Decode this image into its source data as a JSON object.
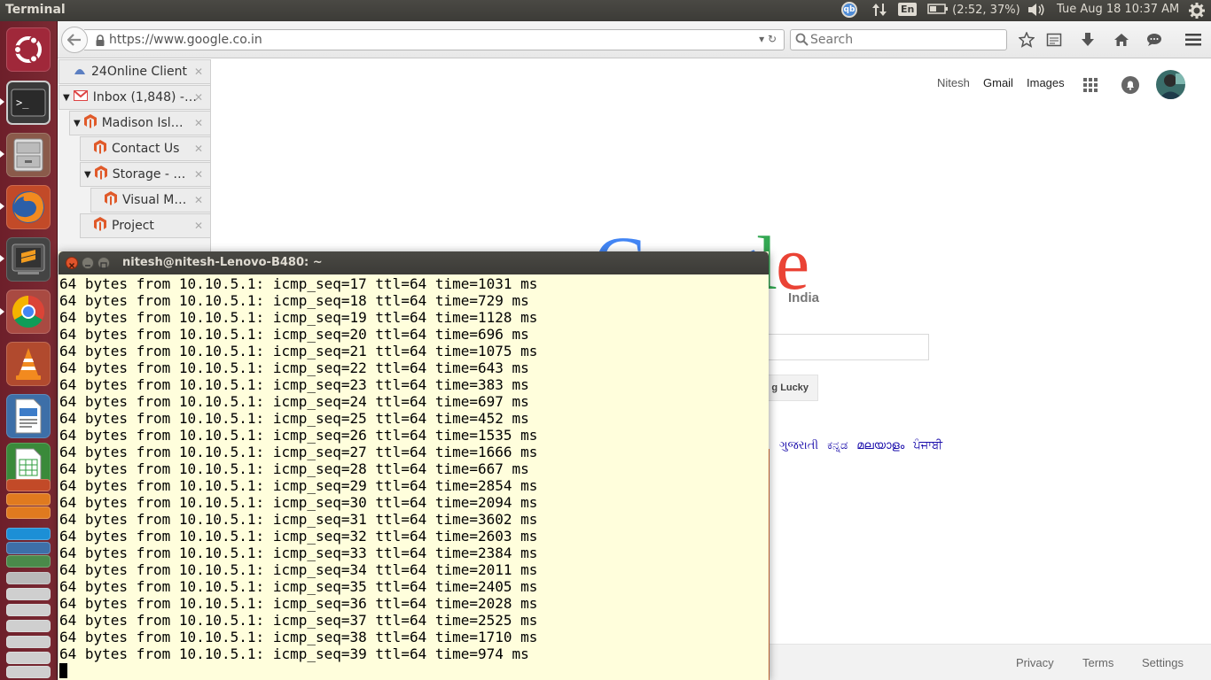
{
  "topbar": {
    "app_title": "Terminal",
    "keyboard_layout": "En",
    "battery": "(2:52, 37%)",
    "clock": "Tue Aug 18 10:37 AM",
    "tray_badge": "qb"
  },
  "launcher": {
    "items": [
      {
        "name": "ubuntu-dash",
        "icon": "ubuntu-logo-icon"
      },
      {
        "name": "terminal",
        "icon": "terminal-icon"
      },
      {
        "name": "files",
        "icon": "file-cabinet-icon"
      },
      {
        "name": "firefox",
        "icon": "firefox-icon"
      },
      {
        "name": "sublime-text",
        "icon": "sublime-icon"
      },
      {
        "name": "chrome",
        "icon": "chrome-icon"
      },
      {
        "name": "vlc",
        "icon": "vlc-cone-icon"
      },
      {
        "name": "libreoffice-writer",
        "icon": "writer-document-icon"
      },
      {
        "name": "libreoffice-calc",
        "icon": "calc-spreadsheet-icon"
      }
    ]
  },
  "browser": {
    "url": "https://www.google.co.in",
    "search_placeholder": "Search",
    "tabs": [
      {
        "label": "24Online Client",
        "indent": 0,
        "favicon": "24online-icon"
      },
      {
        "label": "Inbox (1,848) -…",
        "indent": 0,
        "favicon": "gmail-icon",
        "expanded": true
      },
      {
        "label": "Madison Isl…",
        "indent": 1,
        "favicon": "magento-icon",
        "expanded": true
      },
      {
        "label": "Contact Us",
        "indent": 2,
        "favicon": "magento-icon"
      },
      {
        "label": "Storage - …",
        "indent": 2,
        "favicon": "magento-icon",
        "expanded": true
      },
      {
        "label": "Visual M…",
        "indent": 3,
        "favicon": "magento-icon"
      },
      {
        "label": "Project",
        "indent": 2,
        "favicon": "magento-icon"
      }
    ],
    "google": {
      "header_links": [
        "Nitesh",
        "Gmail",
        "Images"
      ],
      "logo_country": "India",
      "lucky_button": "g Lucky",
      "languages": "ગુજરાતી ಕನ್ನಡ മലയാളം ਪੰਜਾਬੀ",
      "footer": {
        "privacy": "Privacy",
        "terms": "Terms",
        "settings": "Settings"
      }
    }
  },
  "terminal": {
    "title": "nitesh@nitesh-Lenovo-B480: ~",
    "lines": [
      "64 bytes from 10.10.5.1: icmp_seq=17 ttl=64 time=1031 ms",
      "64 bytes from 10.10.5.1: icmp_seq=18 ttl=64 time=729 ms",
      "64 bytes from 10.10.5.1: icmp_seq=19 ttl=64 time=1128 ms",
      "64 bytes from 10.10.5.1: icmp_seq=20 ttl=64 time=696 ms",
      "64 bytes from 10.10.5.1: icmp_seq=21 ttl=64 time=1075 ms",
      "64 bytes from 10.10.5.1: icmp_seq=22 ttl=64 time=643 ms",
      "64 bytes from 10.10.5.1: icmp_seq=23 ttl=64 time=383 ms",
      "64 bytes from 10.10.5.1: icmp_seq=24 ttl=64 time=697 ms",
      "64 bytes from 10.10.5.1: icmp_seq=25 ttl=64 time=452 ms",
      "64 bytes from 10.10.5.1: icmp_seq=26 ttl=64 time=1535 ms",
      "64 bytes from 10.10.5.1: icmp_seq=27 ttl=64 time=1666 ms",
      "64 bytes from 10.10.5.1: icmp_seq=28 ttl=64 time=667 ms",
      "64 bytes from 10.10.5.1: icmp_seq=29 ttl=64 time=2854 ms",
      "64 bytes from 10.10.5.1: icmp_seq=30 ttl=64 time=2094 ms",
      "64 bytes from 10.10.5.1: icmp_seq=31 ttl=64 time=3602 ms",
      "64 bytes from 10.10.5.1: icmp_seq=32 ttl=64 time=2603 ms",
      "64 bytes from 10.10.5.1: icmp_seq=33 ttl=64 time=2384 ms",
      "64 bytes from 10.10.5.1: icmp_seq=34 ttl=64 time=2011 ms",
      "64 bytes from 10.10.5.1: icmp_seq=35 ttl=64 time=2405 ms",
      "64 bytes from 10.10.5.1: icmp_seq=36 ttl=64 time=2028 ms",
      "64 bytes from 10.10.5.1: icmp_seq=37 ttl=64 time=2525 ms",
      "64 bytes from 10.10.5.1: icmp_seq=38 ttl=64 time=1710 ms",
      "64 bytes from 10.10.5.1: icmp_seq=39 ttl=64 time=974 ms"
    ]
  },
  "colors": {
    "launcher_bg": "#7b2a33",
    "panel_bg": "#3c3b37",
    "terminal_bg": "#fffedc",
    "google_blue": "#4285f4",
    "google_red": "#ea4335",
    "google_yellow": "#fbbc05",
    "google_green": "#34a853"
  }
}
